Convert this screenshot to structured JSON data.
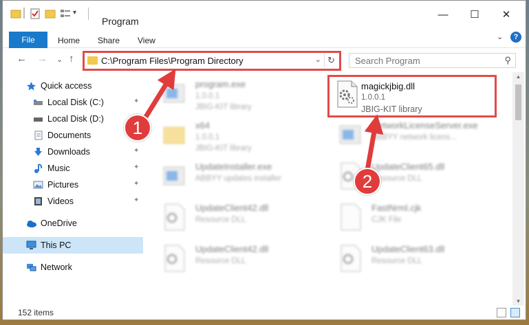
{
  "window": {
    "title": "Program",
    "minimize_glyph": "—",
    "maximize_glyph": "☐",
    "close_glyph": "✕"
  },
  "ribbon": {
    "tabs": [
      "File",
      "Home",
      "Share",
      "View"
    ],
    "expand_glyph": "⌄",
    "help_glyph": "?"
  },
  "nav": {
    "back_glyph": "←",
    "forward_glyph": "→",
    "recent_glyph": "⌄",
    "up_glyph": "↑",
    "address": "C:\\Program Files\\Program Directory",
    "address_dropdown_glyph": "⌄",
    "refresh_glyph": "↻",
    "search_placeholder": "Search Program",
    "search_glyph": "⚲"
  },
  "sidebar": {
    "items": [
      {
        "label": "Quick access",
        "icon": "star-icon",
        "pinned": false
      },
      {
        "label": "Local Disk (C:)",
        "icon": "drive-icon",
        "pinned": true
      },
      {
        "label": "Local Disk (D:)",
        "icon": "drive-icon",
        "pinned": false
      },
      {
        "label": "Documents",
        "icon": "documents-icon",
        "pinned": false
      },
      {
        "label": "Downloads",
        "icon": "downloads-icon",
        "pinned": true
      },
      {
        "label": "Music",
        "icon": "music-icon",
        "pinned": true
      },
      {
        "label": "Pictures",
        "icon": "pictures-icon",
        "pinned": true
      },
      {
        "label": "Videos",
        "icon": "videos-icon",
        "pinned": true
      },
      {
        "label": "OneDrive",
        "icon": "onedrive-icon",
        "pinned": false
      },
      {
        "label": "This PC",
        "icon": "this-pc-icon",
        "pinned": false,
        "selected": true
      },
      {
        "label": "Network",
        "icon": "network-icon",
        "pinned": false
      }
    ],
    "pin_glyph": "📌"
  },
  "files": [
    {
      "name": "program.exe",
      "version": "1.0.0.1",
      "description": "JBIG-KIT library",
      "icon": "exe-icon",
      "blurred": true
    },
    {
      "name": "magickjbig.dll",
      "version": "1.0.0.1",
      "description": "JBIG-KIT library",
      "icon": "dll-gear-icon",
      "blurred": false,
      "highlighted": true
    },
    {
      "name": "x64",
      "version": "1.0.0.1",
      "description": "JBIG-KIT library",
      "icon": "folder-icon",
      "blurred": true
    },
    {
      "name": "NetworkLicenseServer.exe",
      "version": "",
      "description": "ABBYY network licens...",
      "icon": "exe-icon",
      "blurred": true
    },
    {
      "name": "UpdateInstaller.exe",
      "version": "",
      "description": "ABBYY updates installer",
      "icon": "exe-icon",
      "blurred": true
    },
    {
      "name": "UpdateClient65.dll",
      "version": "",
      "description": "Resource DLL",
      "icon": "dll-gear-icon",
      "blurred": true
    },
    {
      "name": "UpdateClient42.dll",
      "version": "",
      "description": "Resource DLL",
      "icon": "dll-gear-icon",
      "blurred": true
    },
    {
      "name": "FastNrml.cjk",
      "version": "",
      "description": "CJK File",
      "icon": "file-icon",
      "blurred": true
    },
    {
      "name": "UpdateClient42.dll",
      "version": "",
      "description": "Resource DLL",
      "icon": "dll-gear-icon",
      "blurred": true
    },
    {
      "name": "UpdateClient63.dll",
      "version": "",
      "description": "Resource DLL",
      "icon": "dll-gear-icon",
      "blurred": true
    }
  ],
  "status": {
    "item_count": "152 items"
  },
  "annotations": {
    "marker_1": "1",
    "marker_2": "2",
    "color": "#e03c3c"
  },
  "colors": {
    "accent": "#1979ca",
    "highlight": "#e24a4a",
    "selected_bg": "#cce5f8"
  }
}
